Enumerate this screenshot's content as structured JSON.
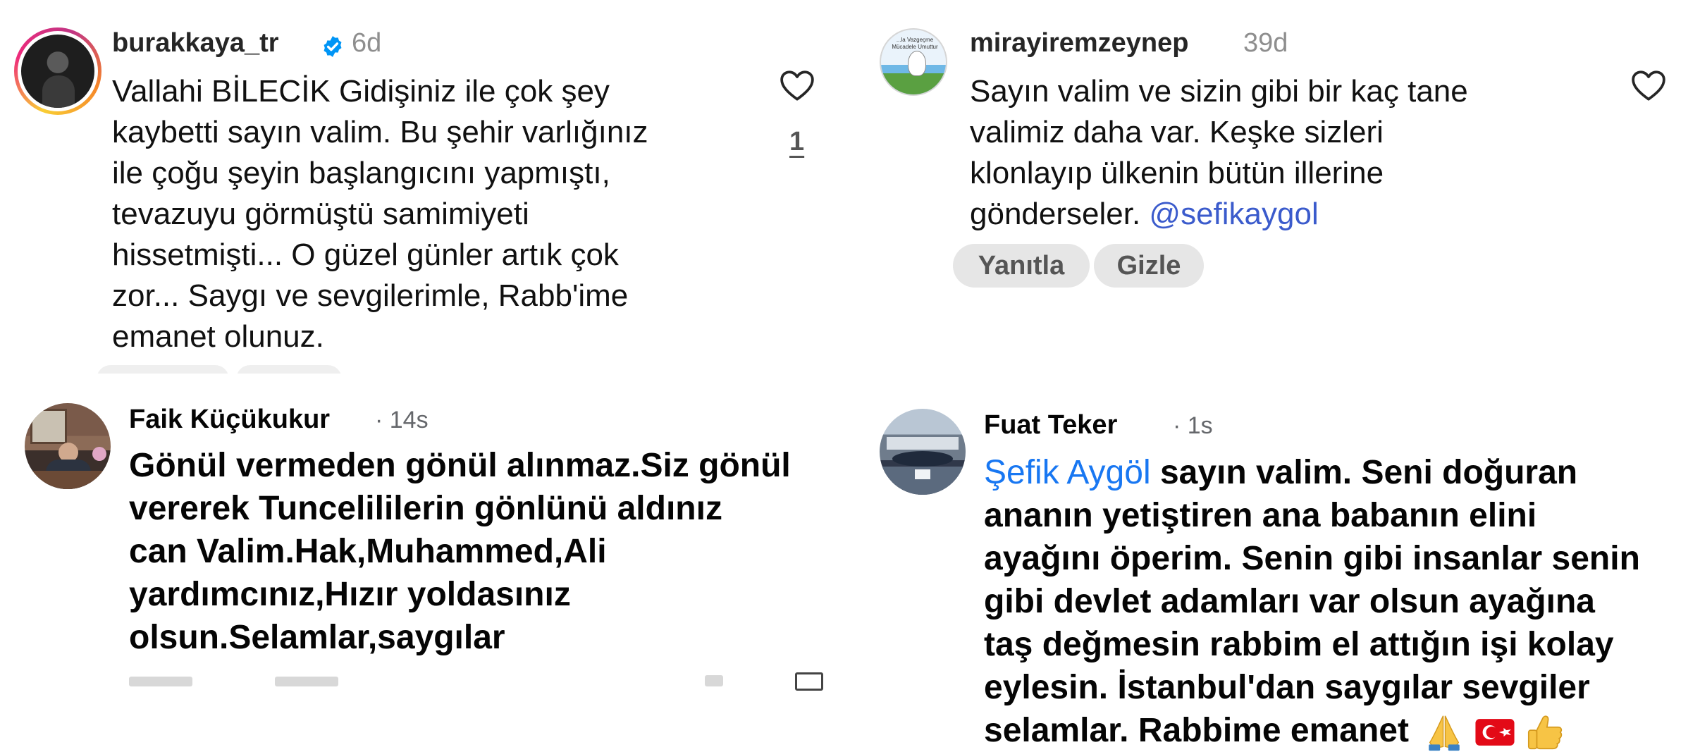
{
  "comments": [
    {
      "username": "burakkaya_tr",
      "verified": true,
      "time": "6d",
      "text_lines": [
        "Vallahi BİLECİK Gidişiniz ile çok şey",
        "kaybetti sayın valim. Bu şehir varlığınız",
        "ile çoğu şeyin başlangıcını yapmıştı,",
        "tevazuyu görmüştü samimiyeti",
        "hissetmişti... O güzel günler artık çok",
        "zor... Saygı ve sevgilerimle, Rabb'ime",
        "emanet olunuz."
      ],
      "like_count": "1",
      "icons": [
        "avatar-story-ring",
        "verified-badge-icon",
        "heart-icon"
      ]
    },
    {
      "username": "mirayiremzeynep",
      "time": "39d",
      "text_lines": [
        "Sayın valim ve sizin gibi bir kaç tane",
        "valimiz daha var. Keşke sizleri",
        "klonlayıp ülkenin bütün illerine"
      ],
      "last_line_prefix": "gönderseler. ",
      "mention": "@sefikaygol",
      "reply_label": "Yanıtla",
      "hide_label": "Gizle",
      "avatar_text": [
        "...la Vazgeçme",
        "Mücadele Umuttur"
      ],
      "icons": [
        "heart-icon"
      ]
    },
    {
      "username": "Faik Küçükukur",
      "time": "· 14s",
      "text_lines": [
        "Gönül vermeden gönül alınmaz.Siz gönül",
        "vererek Tuncelililerin gönlünü aldınız",
        "can Valim.Hak,Muhammed,Ali",
        "yardımcınız,Hızır yoldasınız",
        "olsun.Selamlar,saygılar"
      ]
    },
    {
      "username": "Fuat Teker",
      "time": "· 1s",
      "mention": "Şefik Aygöl",
      "first_line_rest": " sayın valim. Seni doğuran",
      "text_lines": [
        "ananın yetiştiren ana babanın elini",
        "ayağını öperim. Senin gibi insanlar senin",
        "gibi devlet adamları var olsun ayağına",
        "taş değmesin rabbim el attığın işi kolay",
        "eylesin. İstanbul'dan saygılar sevgiler"
      ],
      "last_line": "selamlar. Rabbime emanet",
      "emojis": [
        "folded-hands-icon",
        "turkey-flag-icon",
        "thumbs-up-icon"
      ]
    }
  ],
  "colors": {
    "ig_mention": "#3b5bcc",
    "fb_mention": "#1877f2",
    "verified": "#0095f6",
    "pill_bg": "#e6e6e6"
  }
}
